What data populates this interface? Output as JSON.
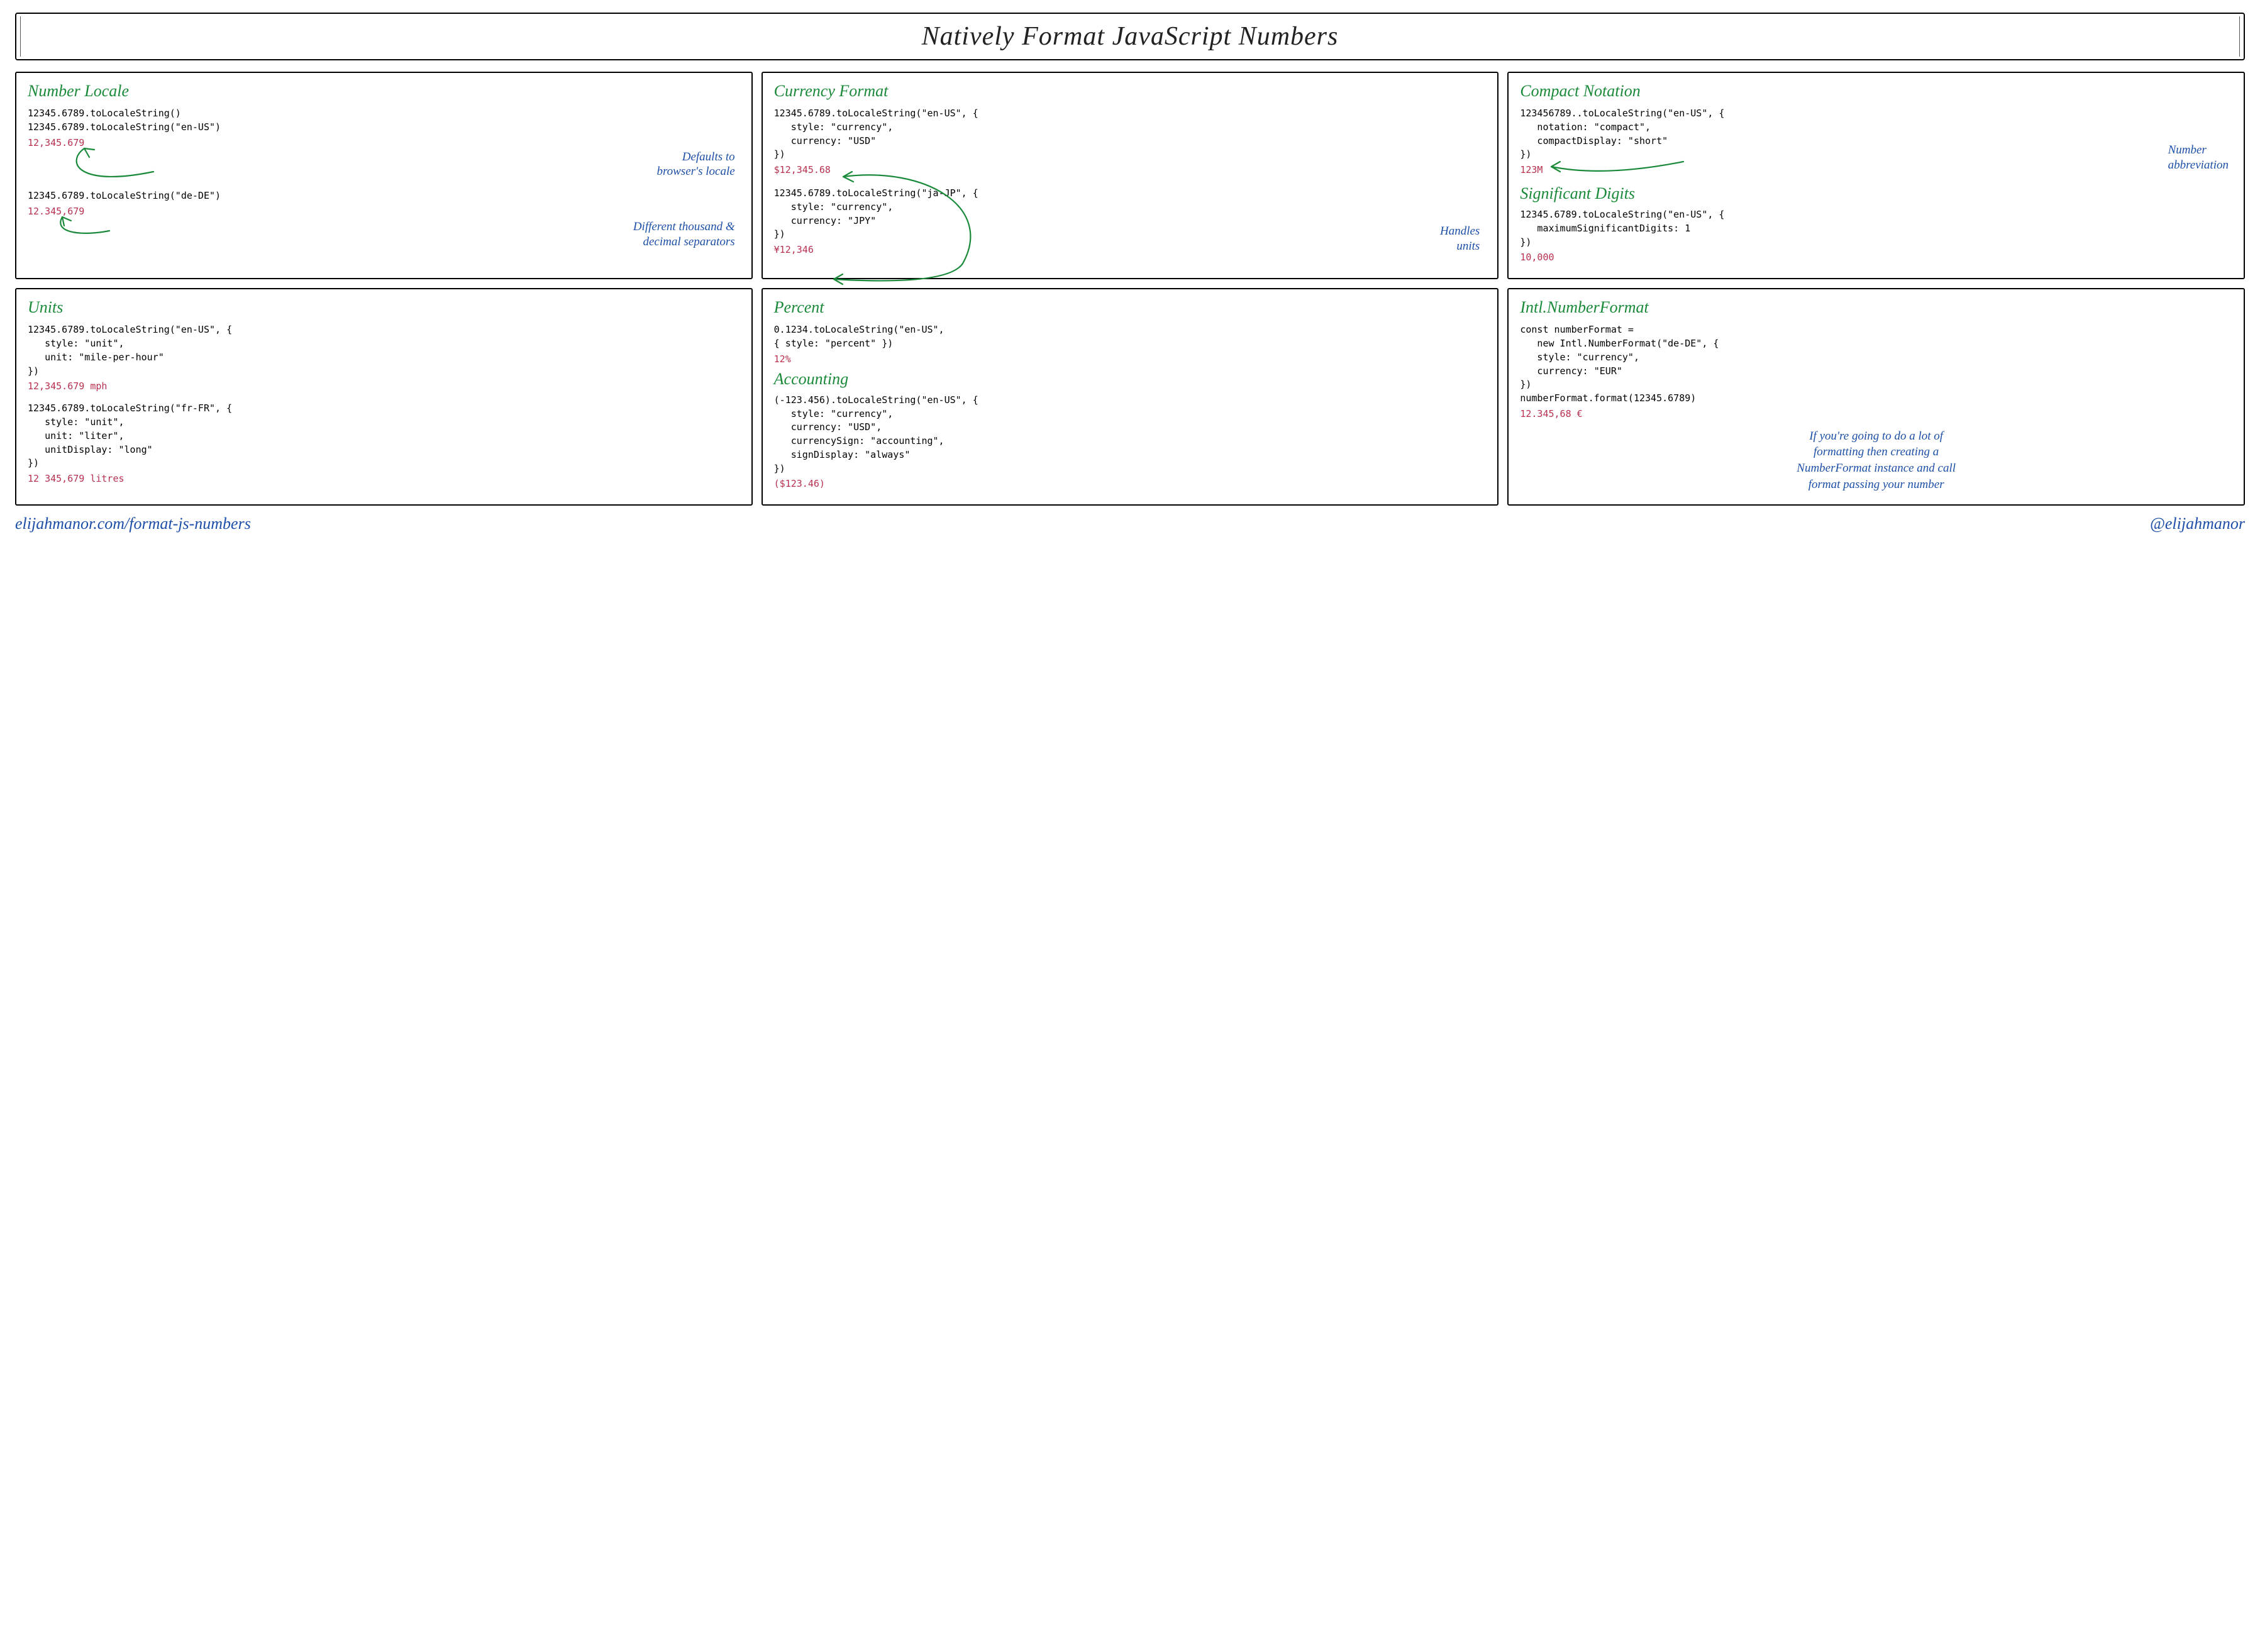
{
  "title": "Natively Format JavaScript Numbers",
  "cards": {
    "locale": {
      "heading": "Number Locale",
      "code1": "12345.6789.toLocaleString()\n12345.6789.toLocaleString(\"en-US\")",
      "out1": "12,345.679",
      "annot1": "Defaults to\nbrowser's locale",
      "code2": "12345.6789.toLocaleString(\"de-DE\")",
      "out2": "12.345,679",
      "annot2": "Different thousand &\ndecimal separators"
    },
    "currency": {
      "heading": "Currency Format",
      "code1": "12345.6789.toLocaleString(\"en-US\", {\n   style: \"currency\",\n   currency: \"USD\"\n})",
      "out1": "$12,345.68",
      "code2": "12345.6789.toLocaleString(\"ja-JP\", {\n   style: \"currency\",\n   currency: \"JPY\"\n})",
      "out2": "¥12,346",
      "annot1": "Handles\nunits"
    },
    "compact": {
      "heading": "Compact Notation",
      "code1": "123456789..toLocaleString(\"en-US\", {\n   notation: \"compact\",\n   compactDisplay: \"short\"\n})",
      "out1": "123M",
      "annot1": "Number\nabbreviation",
      "heading2": "Significant Digits",
      "code2": "12345.6789.toLocaleString(\"en-US\", {\n   maximumSignificantDigits: 1\n})",
      "out2": "10,000"
    },
    "units": {
      "heading": "Units",
      "code1": "12345.6789.toLocaleString(\"en-US\", {\n   style: \"unit\",\n   unit: \"mile-per-hour\"\n})",
      "out1": "12,345.679 mph",
      "code2": "12345.6789.toLocaleString(\"fr-FR\", {\n   style: \"unit\",\n   unit: \"liter\",\n   unitDisplay: \"long\"\n})",
      "out2": "12 345,679 litres"
    },
    "percent": {
      "heading": "Percent",
      "code1": "0.1234.toLocaleString(\"en-US\",\n{ style: \"percent\" })",
      "out1": "12%",
      "heading2": "Accounting",
      "code2": "(-123.456).toLocaleString(\"en-US\", {\n   style: \"currency\",\n   currency: \"USD\",\n   currencySign: \"accounting\",\n   signDisplay: \"always\"\n})",
      "out2": "($123.46)"
    },
    "intl": {
      "heading": "Intl.NumberFormat",
      "code1": "const numberFormat =\n   new Intl.NumberFormat(\"de-DE\", {\n   style: \"currency\",\n   currency: \"EUR\"\n})\nnumberFormat.format(12345.6789)",
      "out1": "12.345,68 €",
      "note": "If you're going to do a lot of\nformatting then creating a\nNumberFormat instance and call\nformat passing your number"
    }
  },
  "footer": {
    "left": "elijahmanor.com/format-js-numbers",
    "right": "@elijahmanor"
  }
}
